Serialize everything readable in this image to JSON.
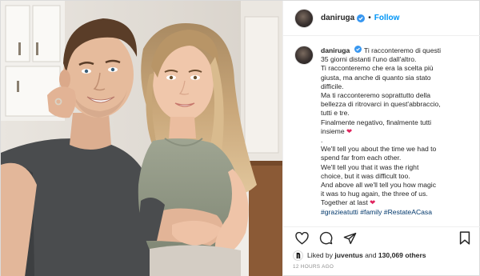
{
  "post": {
    "username": "daniruga",
    "follow_label": "Follow",
    "separator": "•"
  },
  "caption": {
    "username": "daniruga",
    "lines_it": [
      "Ti racconteremo di questi",
      "35 giorni distanti l'uno dall'altro.",
      "Ti racconteremo che era la scelta più",
      "giusta, ma anche di quanto sia stato",
      "difficile.",
      "Ma ti racconteremo soprattutto della",
      "bellezza di ritrovarci in quest'abbraccio,",
      "tutti e tre.",
      "Finalmente negativo, finalmente tutti",
      "insieme"
    ],
    "dot": ".",
    "lines_en": [
      "We'll tell you about the time we had to",
      "spend far from each other.",
      "We'll tell you that it was the right",
      "choice, but it was difficult too.",
      "And above all we'll tell you how magic",
      "it was to hug again, the three of us.",
      "Together at last"
    ],
    "hashtags": "#grazieatutti #family #RestateACasa"
  },
  "actions": {
    "like_icon": "heart-icon",
    "comment_icon": "comment-icon",
    "share_icon": "share-icon",
    "save_icon": "bookmark-icon"
  },
  "likes": {
    "prefix": "Liked by",
    "user": "juventus",
    "middle": "and",
    "count": "130,069 others"
  },
  "timestamp": "12 HOURS AGO",
  "colors": {
    "follow_blue": "#0095f6",
    "hashtag_blue": "#00376b",
    "heart_red": "#e0245e",
    "verified_blue": "#3897f0"
  }
}
